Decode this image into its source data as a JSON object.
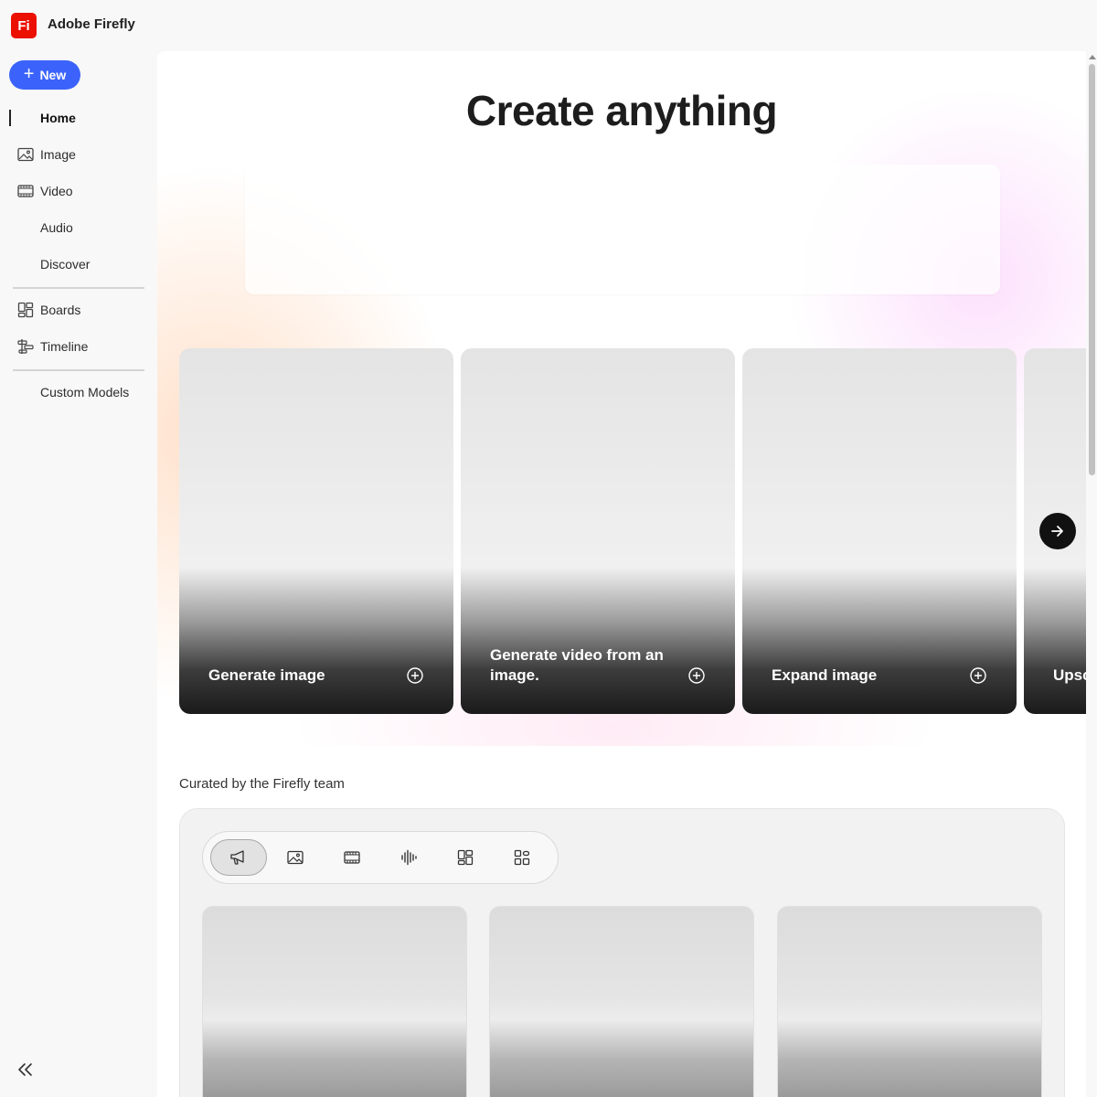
{
  "app": {
    "logo_text": "Fi",
    "name": "Adobe Firefly",
    "brand_color": "#eb1000"
  },
  "sidebar": {
    "new_button": {
      "label": "New",
      "color": "#3b63fb"
    },
    "items": [
      {
        "label": "Home",
        "icon": "none",
        "active": true
      },
      {
        "label": "Image",
        "icon": "image-icon",
        "active": false
      },
      {
        "label": "Video",
        "icon": "video-icon",
        "active": false
      },
      {
        "label": "Audio",
        "icon": "none",
        "active": false
      },
      {
        "label": "Discover",
        "icon": "none",
        "active": false
      },
      {
        "label": "Boards",
        "icon": "boards-icon",
        "active": false
      },
      {
        "label": "Timeline",
        "icon": "timeline-icon",
        "active": false
      },
      {
        "label": "Custom Models",
        "icon": "none",
        "active": false
      }
    ],
    "collapse_icon": "double-chevron-left-icon"
  },
  "main": {
    "hero_title": "Create anything",
    "cards": [
      {
        "label": "Generate image",
        "icon": "plus-circle-icon"
      },
      {
        "label": "Generate video from an image.",
        "icon": "plus-circle-icon"
      },
      {
        "label": "Expand image",
        "icon": "plus-circle-icon"
      },
      {
        "label": "Upsc",
        "icon": "plus-circle-icon"
      }
    ],
    "next_icon": "arrow-right-icon",
    "curated": {
      "title": "Curated by the Firefly team",
      "filters": [
        {
          "icon": "megaphone-icon",
          "selected": true
        },
        {
          "icon": "image-icon",
          "selected": false
        },
        {
          "icon": "video-icon",
          "selected": false
        },
        {
          "icon": "audio-waveform-icon",
          "selected": false
        },
        {
          "icon": "boards-icon",
          "selected": false
        },
        {
          "icon": "apps-icon",
          "selected": false
        }
      ]
    }
  }
}
